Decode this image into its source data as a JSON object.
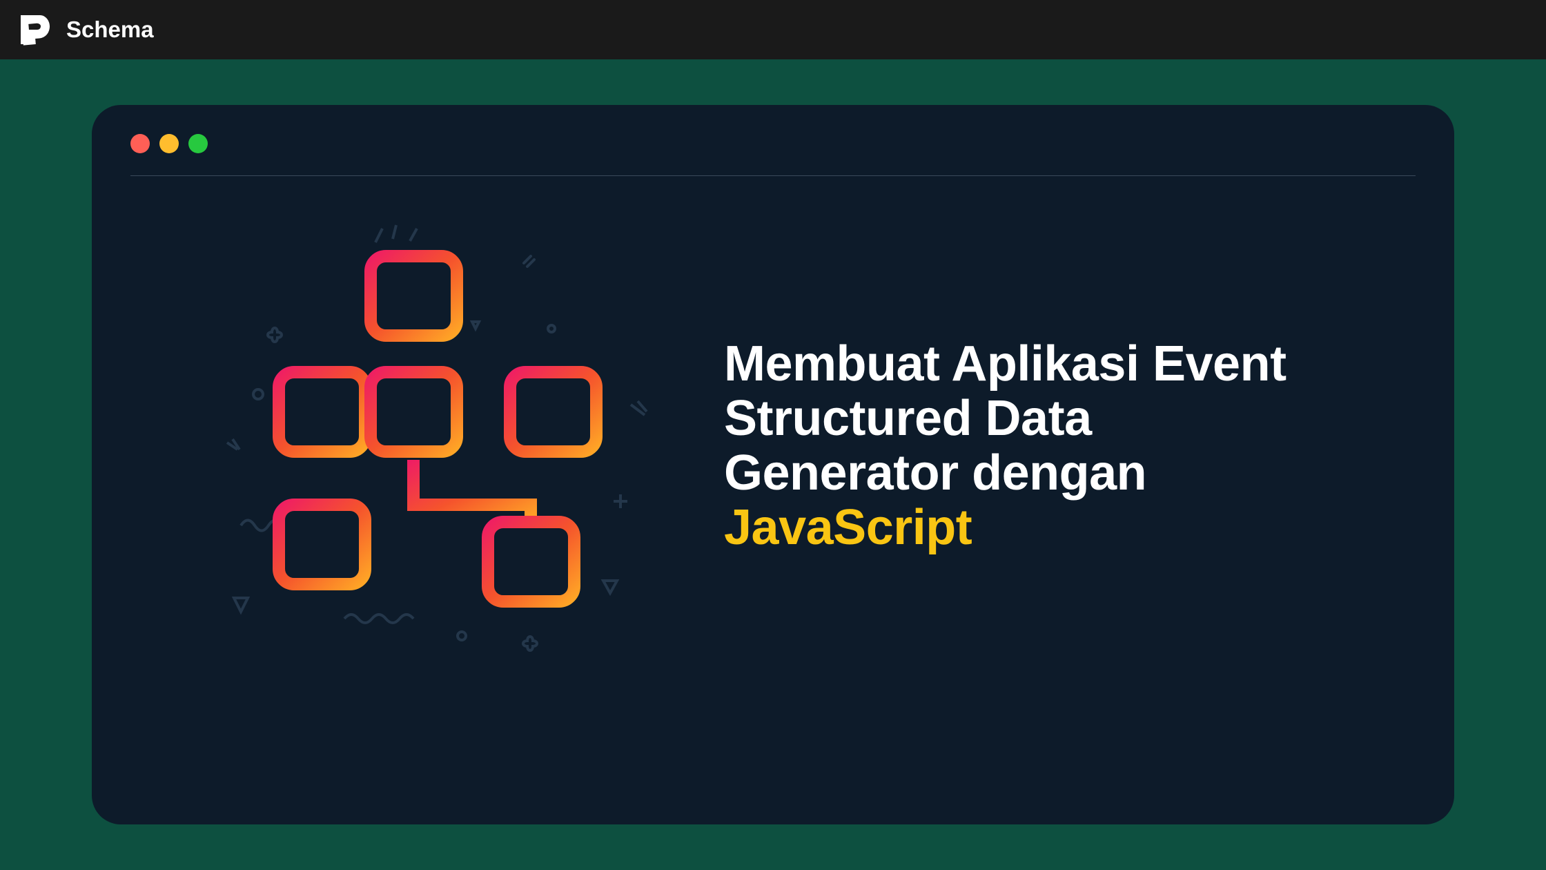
{
  "header": {
    "logo_text": "Schema"
  },
  "card": {
    "title_line1": "Membuat Aplikasi Event",
    "title_line2": "Structured Data",
    "title_line3": "Generator dengan",
    "title_highlight": "JavaScript"
  },
  "colors": {
    "bg_page": "#0d5040",
    "bg_header": "#1a1a1a",
    "bg_card": "#0d1b2a",
    "highlight": "#f9c513",
    "traffic_red": "#ff5f56",
    "traffic_yellow": "#ffbd2e",
    "traffic_green": "#27c93f",
    "gradient_start": "#ef1e63",
    "gradient_end": "#ffa726"
  }
}
